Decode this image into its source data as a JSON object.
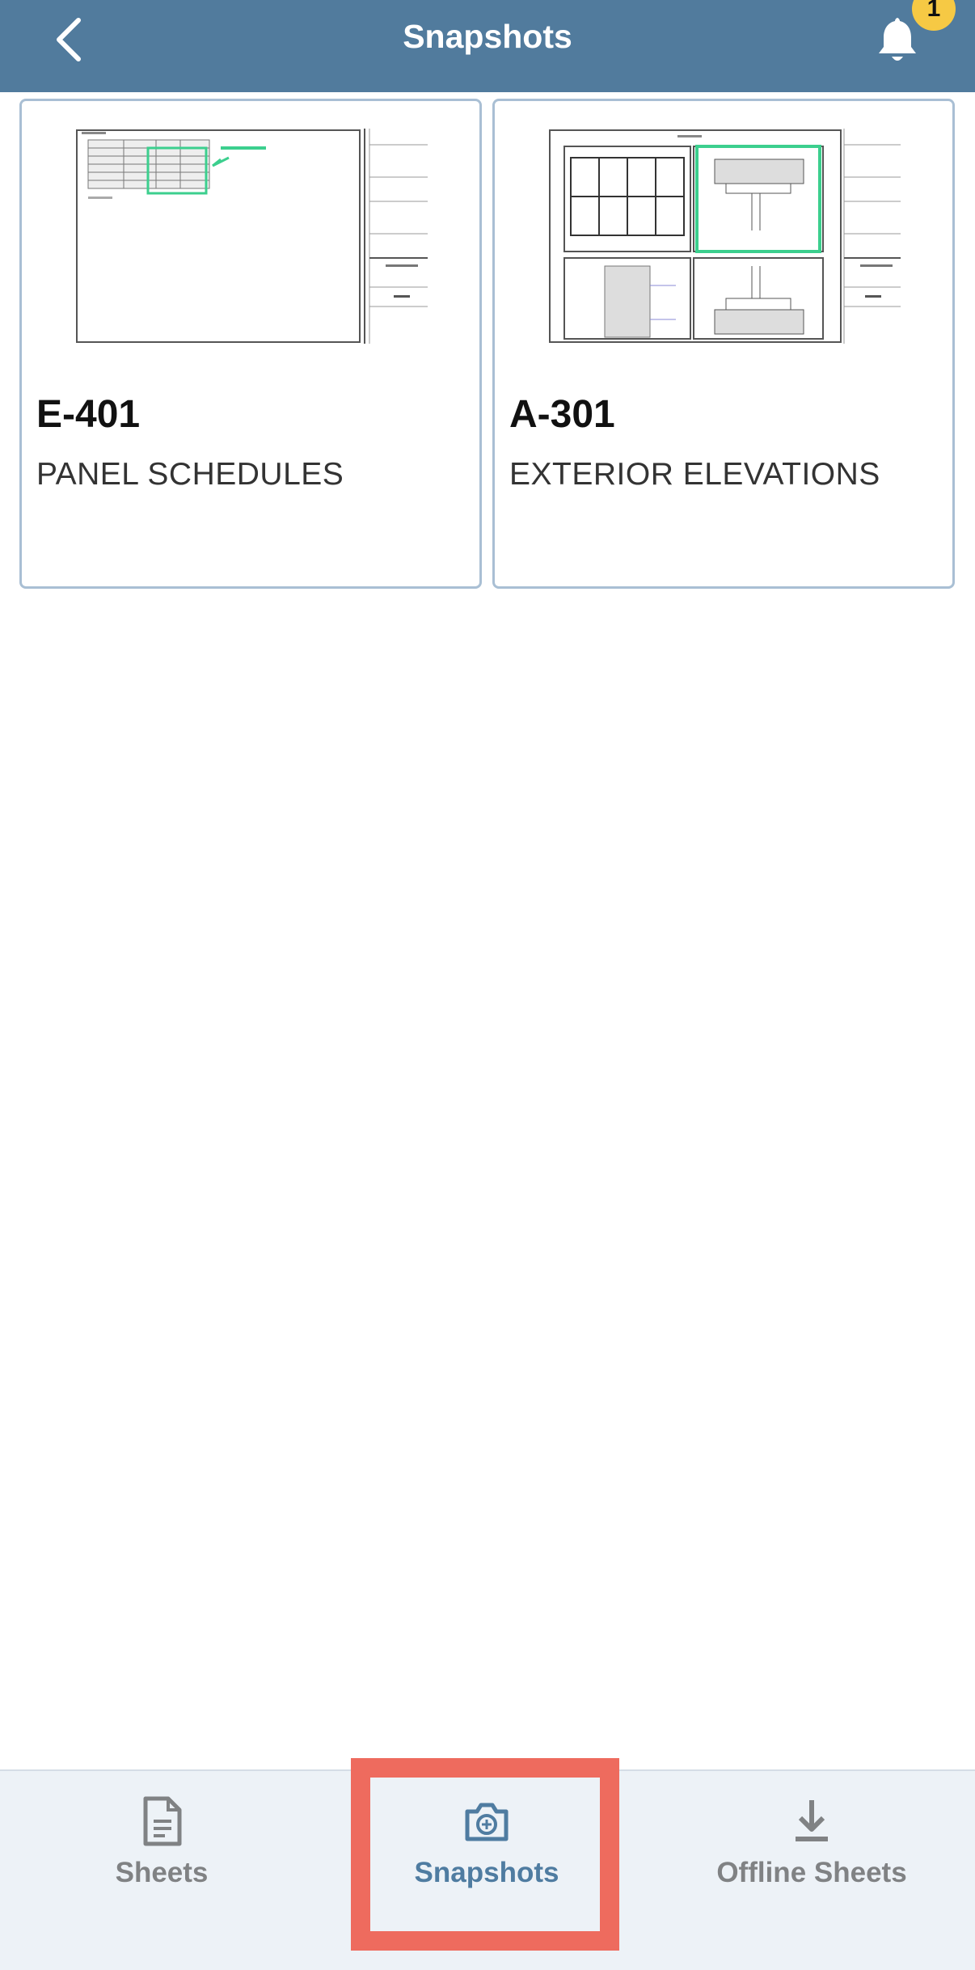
{
  "header": {
    "title": "Snapshots",
    "notification_count": "1"
  },
  "cards": [
    {
      "sheet_number": "E-401",
      "sheet_name": "PANEL SCHEDULES"
    },
    {
      "sheet_number": "A-301",
      "sheet_name": "EXTERIOR ELEVATIONS"
    }
  ],
  "tabs": [
    {
      "label": "Sheets",
      "icon": "document-icon"
    },
    {
      "label": "Snapshots",
      "icon": "camera-icon",
      "active": true
    },
    {
      "label": "Offline Sheets",
      "icon": "download-icon"
    }
  ],
  "colors": {
    "header_bg": "#517b9d",
    "active_tab": "#4f7ca1",
    "inactive_tab": "#808284",
    "badge": "#f6c944",
    "highlight": "#ee6b5e",
    "markup_green": "#3ccf8e"
  }
}
